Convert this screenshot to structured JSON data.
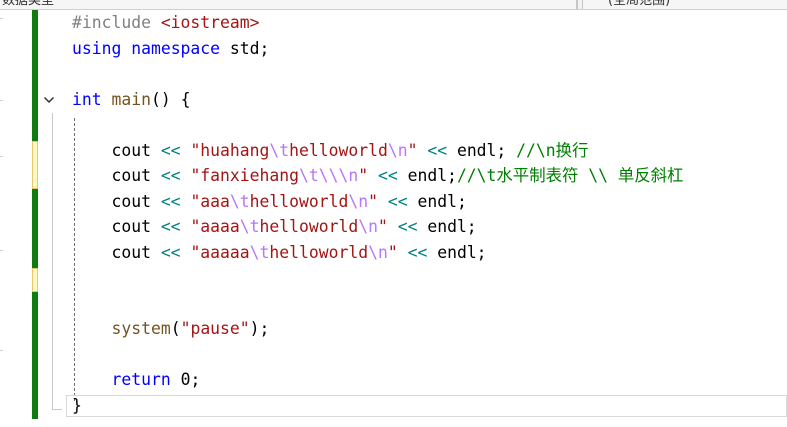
{
  "tabs": {
    "left_label": "数据类型",
    "right_label": "(全局范围)"
  },
  "code_lines": [
    {
      "segments": [
        {
          "t": "#include ",
          "c": "pp"
        },
        {
          "t": "<iostream>",
          "c": "inc"
        }
      ]
    },
    {
      "segments": [
        {
          "t": "using",
          "c": "kw"
        },
        {
          "t": " ",
          "c": "plain"
        },
        {
          "t": "namespace",
          "c": "kw"
        },
        {
          "t": " std;",
          "c": "plain"
        }
      ]
    },
    {
      "segments": []
    },
    {
      "segments": [
        {
          "t": "int",
          "c": "kw"
        },
        {
          "t": " ",
          "c": "plain"
        },
        {
          "t": "main",
          "c": "fn"
        },
        {
          "t": "() {",
          "c": "plain"
        }
      ]
    },
    {
      "segments": []
    },
    {
      "segments": [
        {
          "t": "    cout ",
          "c": "plain"
        },
        {
          "t": "<<",
          "c": "op"
        },
        {
          "t": " ",
          "c": "plain"
        },
        {
          "t": "\"huahang",
          "c": "str"
        },
        {
          "t": "\\t",
          "c": "esc"
        },
        {
          "t": "helloworld",
          "c": "str"
        },
        {
          "t": "\\n",
          "c": "esc"
        },
        {
          "t": "\"",
          "c": "str"
        },
        {
          "t": " ",
          "c": "plain"
        },
        {
          "t": "<<",
          "c": "op"
        },
        {
          "t": " endl; ",
          "c": "plain"
        },
        {
          "t": "//\\n换行",
          "c": "cm"
        }
      ]
    },
    {
      "segments": [
        {
          "t": "    cout ",
          "c": "plain"
        },
        {
          "t": "<<",
          "c": "op"
        },
        {
          "t": " ",
          "c": "plain"
        },
        {
          "t": "\"fanxiehang",
          "c": "str"
        },
        {
          "t": "\\t\\\\\\n",
          "c": "esc"
        },
        {
          "t": "\"",
          "c": "str"
        },
        {
          "t": " ",
          "c": "plain"
        },
        {
          "t": "<<",
          "c": "op"
        },
        {
          "t": " endl;",
          "c": "plain"
        },
        {
          "t": "//\\t水平制表符 \\\\ 单反斜杠",
          "c": "cm"
        }
      ]
    },
    {
      "segments": [
        {
          "t": "    cout ",
          "c": "plain"
        },
        {
          "t": "<<",
          "c": "op"
        },
        {
          "t": " ",
          "c": "plain"
        },
        {
          "t": "\"aaa",
          "c": "str"
        },
        {
          "t": "\\t",
          "c": "esc"
        },
        {
          "t": "helloworld",
          "c": "str"
        },
        {
          "t": "\\n",
          "c": "esc"
        },
        {
          "t": "\"",
          "c": "str"
        },
        {
          "t": " ",
          "c": "plain"
        },
        {
          "t": "<<",
          "c": "op"
        },
        {
          "t": " endl;",
          "c": "plain"
        }
      ]
    },
    {
      "segments": [
        {
          "t": "    cout ",
          "c": "plain"
        },
        {
          "t": "<<",
          "c": "op"
        },
        {
          "t": " ",
          "c": "plain"
        },
        {
          "t": "\"aaaa",
          "c": "str"
        },
        {
          "t": "\\t",
          "c": "esc"
        },
        {
          "t": "helloworld",
          "c": "str"
        },
        {
          "t": "\\n",
          "c": "esc"
        },
        {
          "t": "\"",
          "c": "str"
        },
        {
          "t": " ",
          "c": "plain"
        },
        {
          "t": "<<",
          "c": "op"
        },
        {
          "t": " endl;",
          "c": "plain"
        }
      ]
    },
    {
      "segments": [
        {
          "t": "    cout ",
          "c": "plain"
        },
        {
          "t": "<<",
          "c": "op"
        },
        {
          "t": " ",
          "c": "plain"
        },
        {
          "t": "\"aaaaa",
          "c": "str"
        },
        {
          "t": "\\t",
          "c": "esc"
        },
        {
          "t": "helloworld",
          "c": "str"
        },
        {
          "t": "\\n",
          "c": "esc"
        },
        {
          "t": "\"",
          "c": "str"
        },
        {
          "t": " ",
          "c": "plain"
        },
        {
          "t": "<<",
          "c": "op"
        },
        {
          "t": " endl;",
          "c": "plain"
        }
      ]
    },
    {
      "segments": []
    },
    {
      "segments": []
    },
    {
      "segments": [
        {
          "t": "    ",
          "c": "plain"
        },
        {
          "t": "system",
          "c": "fn"
        },
        {
          "t": "(",
          "c": "plain"
        },
        {
          "t": "\"pause\"",
          "c": "str"
        },
        {
          "t": ");",
          "c": "plain"
        }
      ]
    },
    {
      "segments": []
    },
    {
      "segments": [
        {
          "t": "    ",
          "c": "plain"
        },
        {
          "t": "return",
          "c": "kw"
        },
        {
          "t": " 0;",
          "c": "plain"
        }
      ]
    },
    {
      "segments": [
        {
          "t": "}",
          "c": "plain"
        }
      ]
    }
  ],
  "icons": {
    "fold_toggle": "chevron-down-icon"
  },
  "colors": {
    "keyword": "#0000ff",
    "function": "#74531f",
    "string": "#a31515",
    "escape": "#b776fb",
    "operator": "#008080",
    "comment": "#008000",
    "change_bar": "#107c10"
  }
}
